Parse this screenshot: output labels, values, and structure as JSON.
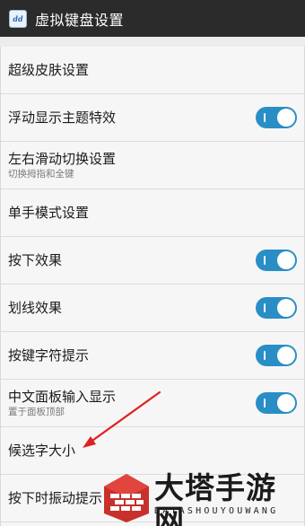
{
  "header": {
    "title": "虚拟键盘设置",
    "app_icon_text": "dd"
  },
  "settings": [
    {
      "label": "超级皮肤设置"
    },
    {
      "label": "浮动显示主题特效",
      "toggle": "on"
    },
    {
      "label": "左右滑动切换设置",
      "subtitle": "切换拇指和全键"
    },
    {
      "label": "单手模式设置"
    },
    {
      "label": "按下效果",
      "toggle": "on"
    },
    {
      "label": "划线效果",
      "toggle": "on"
    },
    {
      "label": "按键字符提示",
      "toggle": "on"
    },
    {
      "label": "中文面板输入显示",
      "subtitle": "置于面板顶部",
      "toggle": "on"
    },
    {
      "label": "候选字大小"
    },
    {
      "label": "按下时振动提示"
    }
  ],
  "watermark": {
    "title": "大塔手游网",
    "subtitle": "DATASHOUYOUWANG"
  },
  "colors": {
    "toggle_on": "#2a8ec6",
    "annotation_arrow": "#e02020",
    "titlebar": "#2b2b2b"
  }
}
